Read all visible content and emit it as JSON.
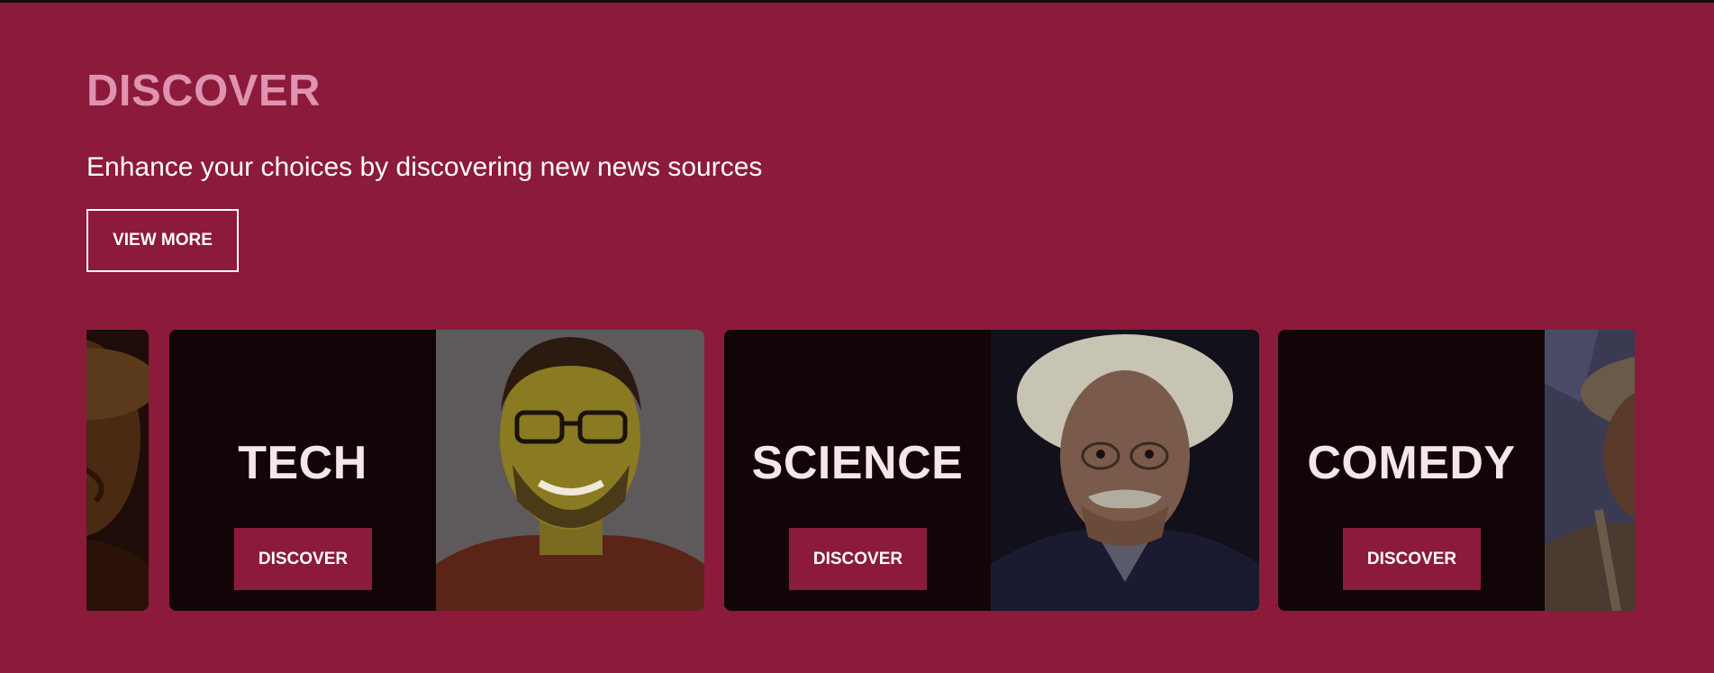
{
  "section": {
    "heading": "DISCOVER",
    "subtitle": "Enhance your choices by discovering new news sources",
    "view_more_label": "VIEW MORE"
  },
  "cards": [
    {
      "title": "TECH",
      "button_label": "DISCOVER",
      "image": "tech-portrait-image"
    },
    {
      "title": "SCIENCE",
      "button_label": "DISCOVER",
      "image": "science-portrait-image"
    },
    {
      "title": "COMEDY",
      "button_label": "DISCOVER",
      "image": "comedy-portrait-image"
    }
  ],
  "colors": {
    "background": "#8c1a3b",
    "heading": "#df93b0",
    "card_bg": "#120508",
    "button_bg": "#8c1a3b"
  }
}
